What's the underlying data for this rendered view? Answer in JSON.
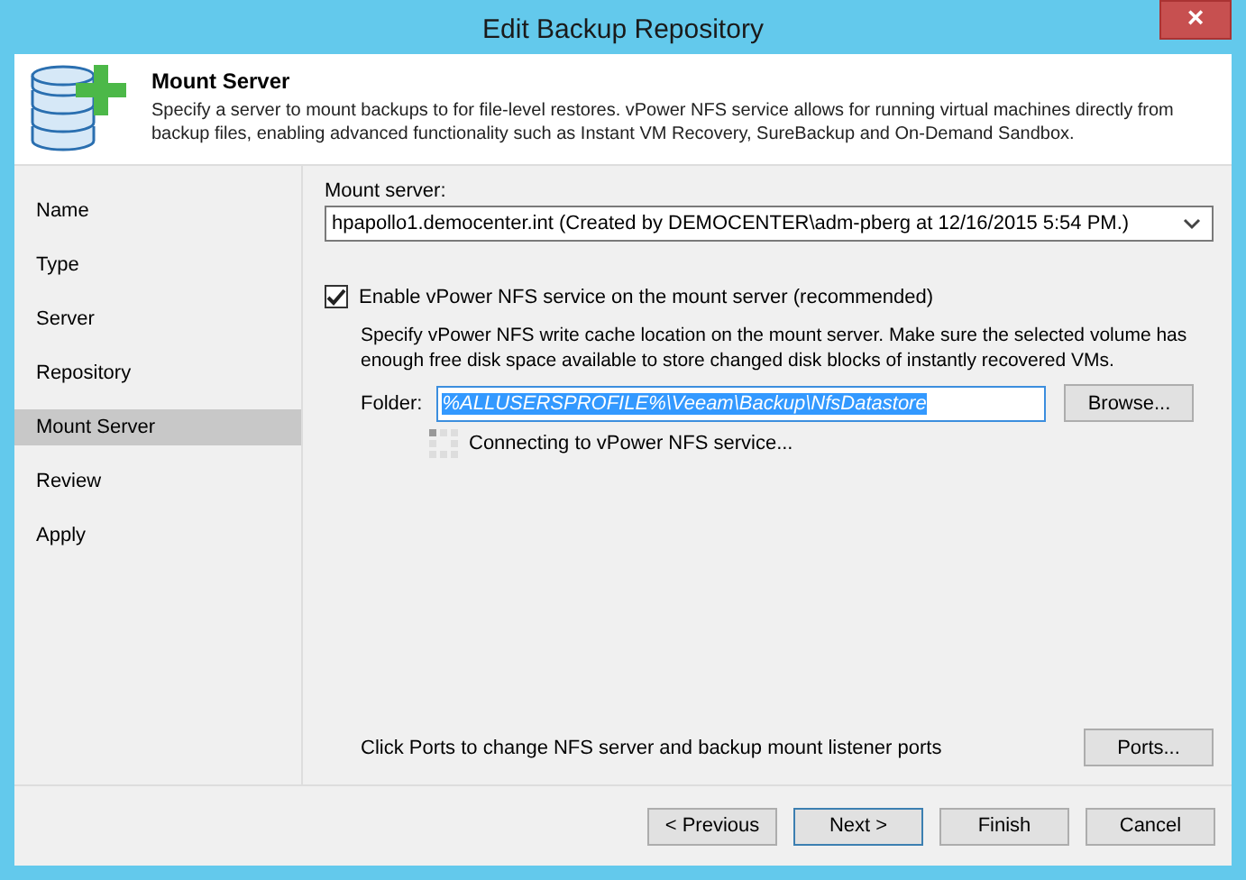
{
  "window": {
    "title": "Edit Backup Repository",
    "close": "×"
  },
  "header": {
    "title": "Mount Server",
    "description": "Specify a server to mount backups to for file-level restores. vPower NFS service allows for running virtual machines directly from backup files, enabling advanced functionality such as Instant VM Recovery, SureBackup and On-Demand Sandbox."
  },
  "steps": [
    {
      "label": "Name",
      "selected": false
    },
    {
      "label": "Type",
      "selected": false
    },
    {
      "label": "Server",
      "selected": false
    },
    {
      "label": "Repository",
      "selected": false
    },
    {
      "label": "Mount Server",
      "selected": true
    },
    {
      "label": "Review",
      "selected": false
    },
    {
      "label": "Apply",
      "selected": false
    }
  ],
  "mount_server": {
    "label": "Mount server:",
    "value": "hpapollo1.democenter.int (Created by DEMOCENTER\\adm-pberg at 12/16/2015 5:54 PM.)"
  },
  "nfs": {
    "label": "Enable vPower NFS service on the mount server (recommended)",
    "checked": true,
    "description": "Specify vPower NFS write cache location on the mount server. Make sure the selected volume has enough free disk space available to store changed disk blocks of instantly recovered VMs.",
    "folder_label": "Folder:",
    "folder_value": "%ALLUSERSPROFILE%\\Veeam\\Backup\\NfsDatastore",
    "folder_text_highlighted": true,
    "browse": "Browse...",
    "status": "Connecting to vPower NFS service..."
  },
  "ports": {
    "text": "Click Ports to change NFS server and backup mount listener ports",
    "button": "Ports..."
  },
  "buttons": [
    {
      "label": "< Previous",
      "default": false
    },
    {
      "label": "Next >",
      "default": true
    },
    {
      "label": "Finish",
      "default": false
    },
    {
      "label": "Cancel",
      "default": false
    }
  ]
}
